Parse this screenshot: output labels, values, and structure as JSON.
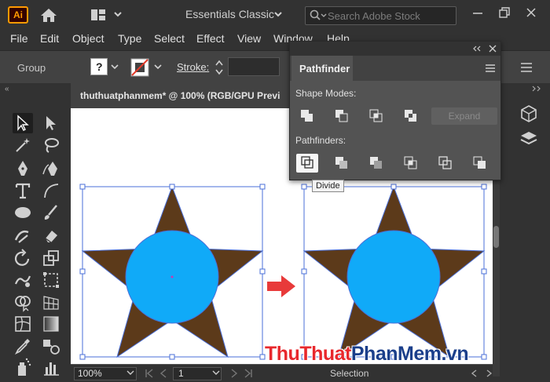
{
  "app": {
    "logo_text": "Ai",
    "workspace": "Essentials Classic",
    "search_placeholder": "Search Adobe Stock"
  },
  "menu": [
    "File",
    "Edit",
    "Object",
    "Type",
    "Select",
    "Effect",
    "View",
    "Window",
    "Help"
  ],
  "control": {
    "selection_label": "Group",
    "stroke_label": "Stroke:"
  },
  "document": {
    "tab_title": "thuthuatphanmem* @ 100% (RGB/GPU Previ",
    "zoom": "100%",
    "page": "1",
    "status": "Selection"
  },
  "pathfinder": {
    "tab": "Pathfinder",
    "shape_modes_label": "Shape Modes:",
    "pathfinders_label": "Pathfinders:",
    "expand_label": "Expand",
    "tooltip": "Divide"
  },
  "watermark": {
    "part1": "Thu",
    "part2": "Thuat",
    "part3": "Phan",
    "part4": "Mem",
    "part5": ".vn"
  },
  "colors": {
    "star": "#5c3a1a",
    "circle": "#10aaf8",
    "arrow": "#e83a3a",
    "accent_orange": "#ff9a00"
  }
}
